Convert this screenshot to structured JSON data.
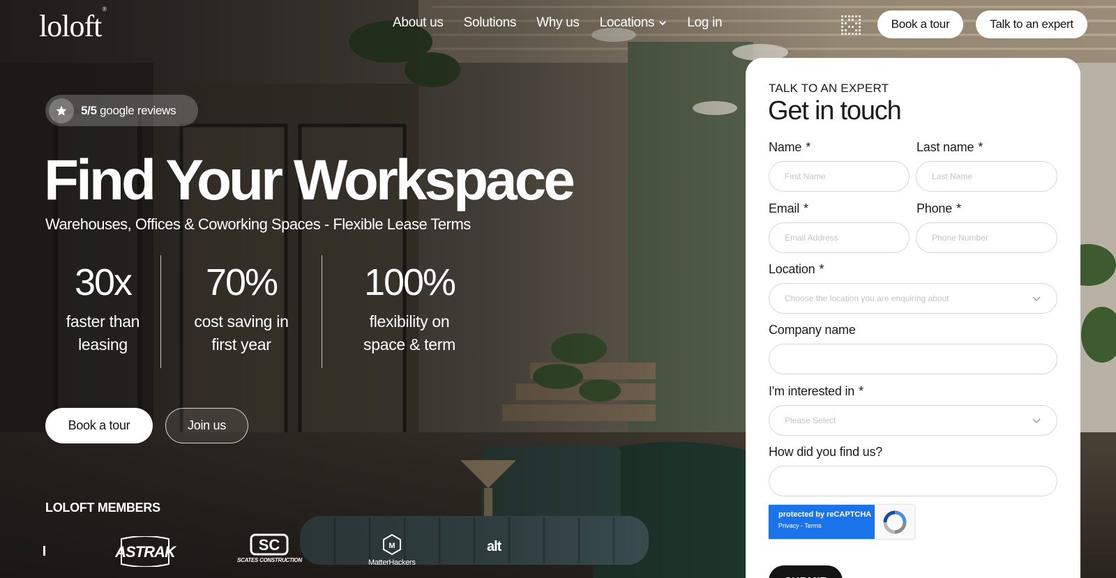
{
  "brand": {
    "logo": "loloft",
    "mark": "®"
  },
  "nav": {
    "items": [
      {
        "label": "About us"
      },
      {
        "label": "Solutions"
      },
      {
        "label": "Why us"
      },
      {
        "label": "Locations"
      },
      {
        "label": "Log in"
      }
    ]
  },
  "header": {
    "book_tour": "Book a tour",
    "talk_expert": "Talk to an expert"
  },
  "hero": {
    "reviews_score": "5/5",
    "reviews_text": " google reviews",
    "title": "Find Your Workspace",
    "subtitle": "Warehouses, Offices & Coworking Spaces - Flexible Lease Terms",
    "stats": [
      {
        "value": "30x",
        "label_line1": "faster than",
        "label_line2": "leasing"
      },
      {
        "value": "70%",
        "label_line1": "cost saving in",
        "label_line2": "first year"
      },
      {
        "value": "100%",
        "label_line1": "flexibility on",
        "label_line2": "space & term"
      }
    ],
    "book_tour": "Book a tour",
    "join_us": "Join us"
  },
  "members": {
    "title": "LOLOFT MEMBERS",
    "logos": [
      "ASTRAK",
      "SCATES CONSTRUCTION",
      "MatterHackers",
      "alt"
    ]
  },
  "form": {
    "eyebrow": "TALK TO AN EXPERT",
    "title": "Get in touch",
    "required_mark": "*",
    "name_label": "Name",
    "name_placeholder": "First Name",
    "last_label": "Last name",
    "last_placeholder": "Last Name",
    "email_label": "Email",
    "email_placeholder": "Email Address",
    "phone_label": "Phone",
    "phone_placeholder": "Phone Number",
    "location_label": "Location",
    "location_placeholder": "Choose the location you are enquiring about",
    "company_label": "Company name",
    "interest_label": "I'm interested in",
    "interest_placeholder": "Please Select",
    "found_label": "How did you find us?",
    "recaptcha_line1": "protected by reCAPTCHA",
    "recaptcha_line2": "Privacy - Terms",
    "submit": "SUBMIT"
  },
  "colors": {
    "accent": "#141414",
    "recaptcha": "#1a73e8",
    "card": "#ffffff"
  },
  "icons": [
    "star-icon",
    "chevron-down-icon",
    "grid-icon",
    "recaptcha-icon"
  ]
}
